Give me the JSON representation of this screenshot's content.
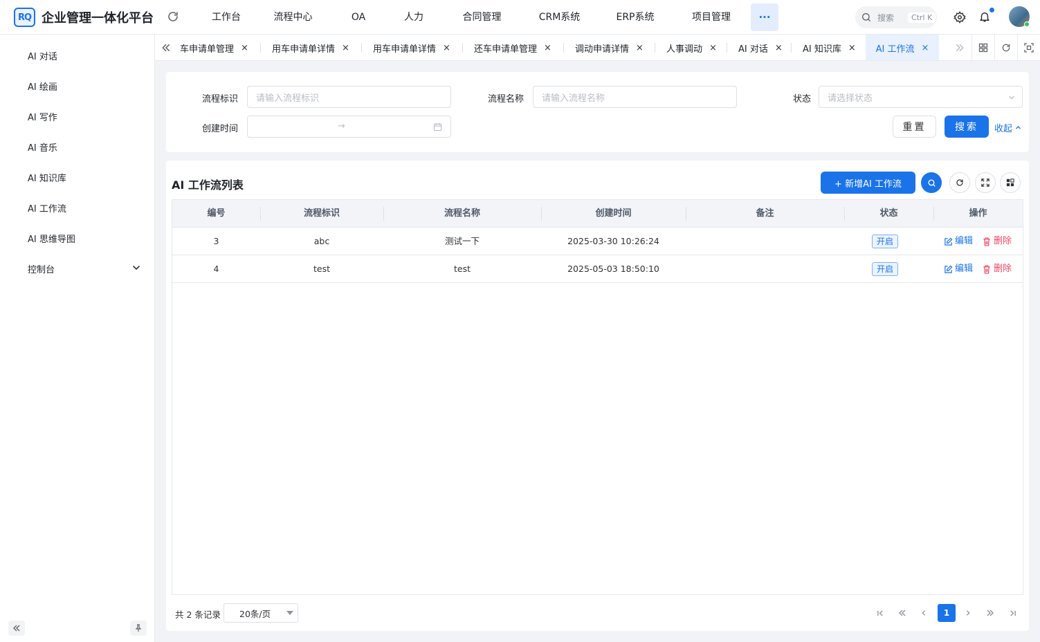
{
  "header": {
    "logo_text": "RQ",
    "app_title": "企业管理一体化平台",
    "nav": [
      "工作台",
      "流程中心",
      "OA",
      "人力",
      "合同管理",
      "CRM系统",
      "ERP系统",
      "项目管理"
    ],
    "more_label": "···",
    "search_placeholder": "搜索",
    "search_shortcut": "Ctrl K"
  },
  "sidebar": {
    "items": [
      "AI 对话",
      "AI 绘画",
      "AI 写作",
      "AI 音乐",
      "AI 知识库",
      "AI 工作流",
      "AI 思维导图",
      "控制台"
    ]
  },
  "tabs": {
    "items": [
      "车申请单管理",
      "用车申请单详情",
      "用车申请单详情",
      "还车申请单管理",
      "调动申请详情",
      "人事调动",
      "AI 对话",
      "AI 知识库",
      "AI 工作流"
    ],
    "active_index": 8,
    "close_glyph": "×"
  },
  "filter": {
    "process_key_label": "流程标识",
    "process_key_placeholder": "请输入流程标识",
    "process_name_label": "流程名称",
    "process_name_placeholder": "请输入流程名称",
    "status_label": "状态",
    "status_placeholder": "请选择状态",
    "created_label": "创建时间",
    "date_arrow": "→",
    "reset_label": "重置",
    "search_label": "搜索",
    "collapse_label": "收起"
  },
  "list": {
    "title": "AI 工作流列表",
    "add_label": "+ 新增AI 工作流",
    "columns": [
      "编号",
      "流程标识",
      "流程名称",
      "创建时间",
      "备注",
      "状态",
      "操作"
    ],
    "rows": [
      {
        "id": "3",
        "key": "abc",
        "name": "测试一下",
        "created": "2025-03-30 10:26:24",
        "remark": "",
        "status": "开启"
      },
      {
        "id": "4",
        "key": "test",
        "name": "test",
        "created": "2025-05-03 18:50:10",
        "remark": "",
        "status": "开启"
      }
    ],
    "edit_label": "编辑",
    "delete_label": "删除"
  },
  "pager": {
    "total_label": "共 2 条记录",
    "page_size": "20条/页",
    "current_page": "1"
  },
  "colors": {
    "primary": "#1a73e8",
    "danger": "#f04864"
  }
}
